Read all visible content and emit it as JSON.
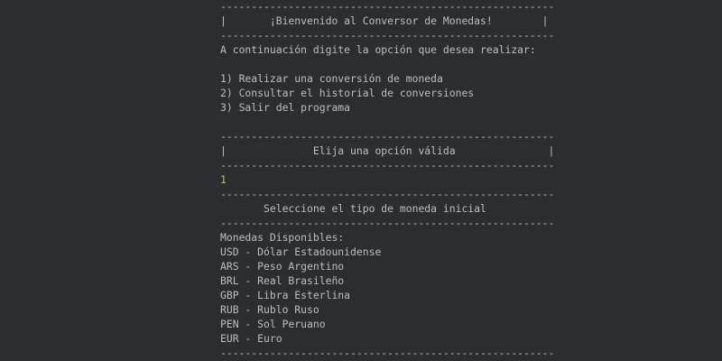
{
  "console": {
    "lines": [
      {
        "text": "------------------------------------------------------",
        "type": "separator"
      },
      {
        "text": "|       ¡Bienvenido al Conversor de Monedas!        |",
        "type": "header"
      },
      {
        "text": "------------------------------------------------------",
        "type": "separator"
      },
      {
        "text": "A continuación digite la opción que desea realizar:",
        "type": "prompt"
      },
      {
        "text": "",
        "type": "blank"
      },
      {
        "text": "1) Realizar una conversión de moneda",
        "type": "menu-option"
      },
      {
        "text": "2) Consultar el historial de conversiones",
        "type": "menu-option"
      },
      {
        "text": "3) Salir del programa",
        "type": "menu-option"
      },
      {
        "text": "",
        "type": "blank"
      },
      {
        "text": "------------------------------------------------------",
        "type": "separator"
      },
      {
        "text": "|              Elija una opción válida               |",
        "type": "header"
      },
      {
        "text": "------------------------------------------------------",
        "type": "separator"
      },
      {
        "text": "1",
        "type": "user-input"
      },
      {
        "text": "------------------------------------------------------",
        "type": "separator"
      },
      {
        "text": "       Seleccione el tipo de moneda inicial",
        "type": "header"
      },
      {
        "text": "------------------------------------------------------",
        "type": "separator"
      },
      {
        "text": "Monedas Disponibles:",
        "type": "prompt"
      },
      {
        "text": "USD - Dólar Estadounidense",
        "type": "currency-option"
      },
      {
        "text": "ARS - Peso Argentino",
        "type": "currency-option"
      },
      {
        "text": "BRL - Real Brasileño",
        "type": "currency-option"
      },
      {
        "text": "GBP - Libra Esterlina",
        "type": "currency-option"
      },
      {
        "text": "RUB - Rublo Ruso",
        "type": "currency-option"
      },
      {
        "text": "PEN - Sol Peruano",
        "type": "currency-option"
      },
      {
        "text": "EUR - Euro",
        "type": "currency-option"
      },
      {
        "text": "------------------------------------------------------",
        "type": "separator"
      }
    ]
  },
  "colors": {
    "background": "#2b2d30",
    "text": "#bcbec4",
    "user_input": "#b5c45f"
  }
}
